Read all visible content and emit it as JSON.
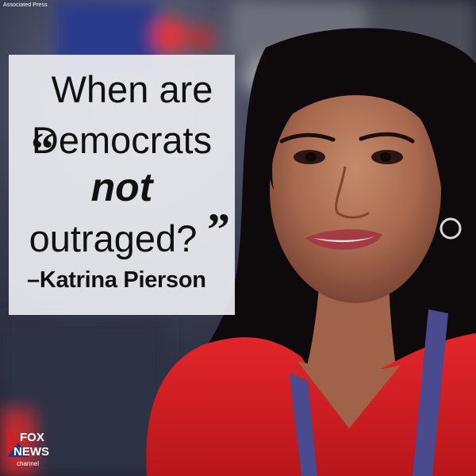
{
  "photo_credit": "Associated Press",
  "quote": {
    "open_mark": "“",
    "close_mark": "”",
    "line1": "When are",
    "line2": "Democrats",
    "line3": "not",
    "line4": "outraged?",
    "attribution": "–Katrina Pierson"
  },
  "logo": {
    "line1": "FOX",
    "line2": "NEWS",
    "line3": "channel"
  },
  "colors": {
    "dress_red": "#d81f24",
    "hair": "#0e0a0c",
    "skin": "#b07458",
    "lanyard": "#4a4a8e",
    "box": "#ecedf0"
  }
}
